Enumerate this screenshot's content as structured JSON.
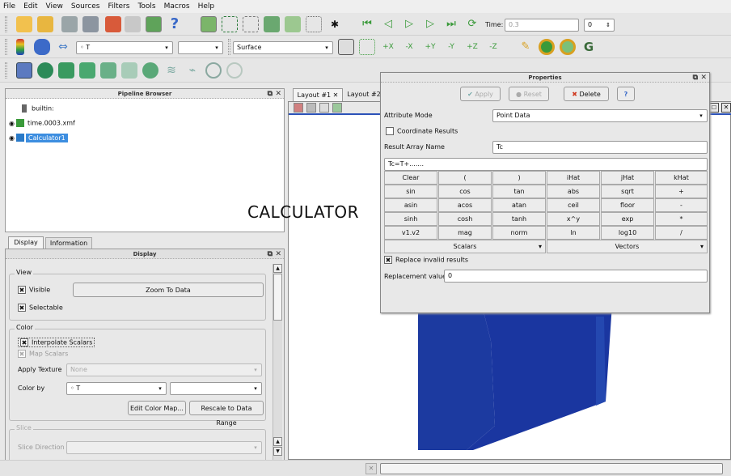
{
  "menu": [
    "File",
    "Edit",
    "View",
    "Sources",
    "Filters",
    "Tools",
    "Macros",
    "Help"
  ],
  "toolbar": {
    "time_label": "Time:",
    "time_value": "0.3",
    "time_index": "0",
    "color_array": "◦ T",
    "representation": "Surface"
  },
  "pipeline": {
    "title": "Pipeline Browser",
    "items": [
      "builtin:",
      "time.0003.xmf",
      "Calculator1"
    ]
  },
  "display_tabs": [
    "Display",
    "Information"
  ],
  "display": {
    "title": "Display",
    "view_group": "View",
    "visible": "Visible",
    "zoom_to_data": "Zoom To Data",
    "selectable": "Selectable",
    "color_group": "Color",
    "interpolate": "Interpolate Scalars",
    "map_scalars": "Map Scalars",
    "apply_texture": "Apply Texture",
    "texture_value": "None",
    "color_by": "Color by",
    "color_by_value": "◦ T",
    "edit_color_map": "Edit Color Map...",
    "rescale": "Rescale to Data Range",
    "slice_group": "Slice",
    "slice_direction": "Slice Direction"
  },
  "layout_tabs": [
    "Layout #1 ✕",
    "Layout #2"
  ],
  "overlay_text": "CALCULATOR",
  "properties": {
    "title": "Properties",
    "apply": "Apply",
    "reset": "Reset",
    "delete": "Delete",
    "help": "?",
    "attribute_mode_label": "Attribute Mode",
    "attribute_mode_value": "Point Data",
    "coordinate_results": "Coordinate Results",
    "result_array_label": "Result Array Name",
    "result_array_value": "Tc",
    "expression": "Tc=T+.......",
    "buttons": [
      [
        "Clear",
        "(",
        ")",
        "iHat",
        "jHat",
        "kHat"
      ],
      [
        "sin",
        "cos",
        "tan",
        "abs",
        "sqrt",
        "+"
      ],
      [
        "asin",
        "acos",
        "atan",
        "ceil",
        "floor",
        "-"
      ],
      [
        "sinh",
        "cosh",
        "tanh",
        "x^y",
        "exp",
        "*"
      ],
      [
        "v1.v2",
        "mag",
        "norm",
        "ln",
        "log10",
        "/"
      ]
    ],
    "scalars": "Scalars",
    "vectors": "Vectors",
    "replace_invalid": "Replace invalid results",
    "replacement_label": "Replacement value",
    "replacement_value": "0"
  },
  "colors": {
    "accent": "#4a90d9",
    "mesh_blue": "#1c3aa0",
    "selected": "#3d8ee0"
  }
}
